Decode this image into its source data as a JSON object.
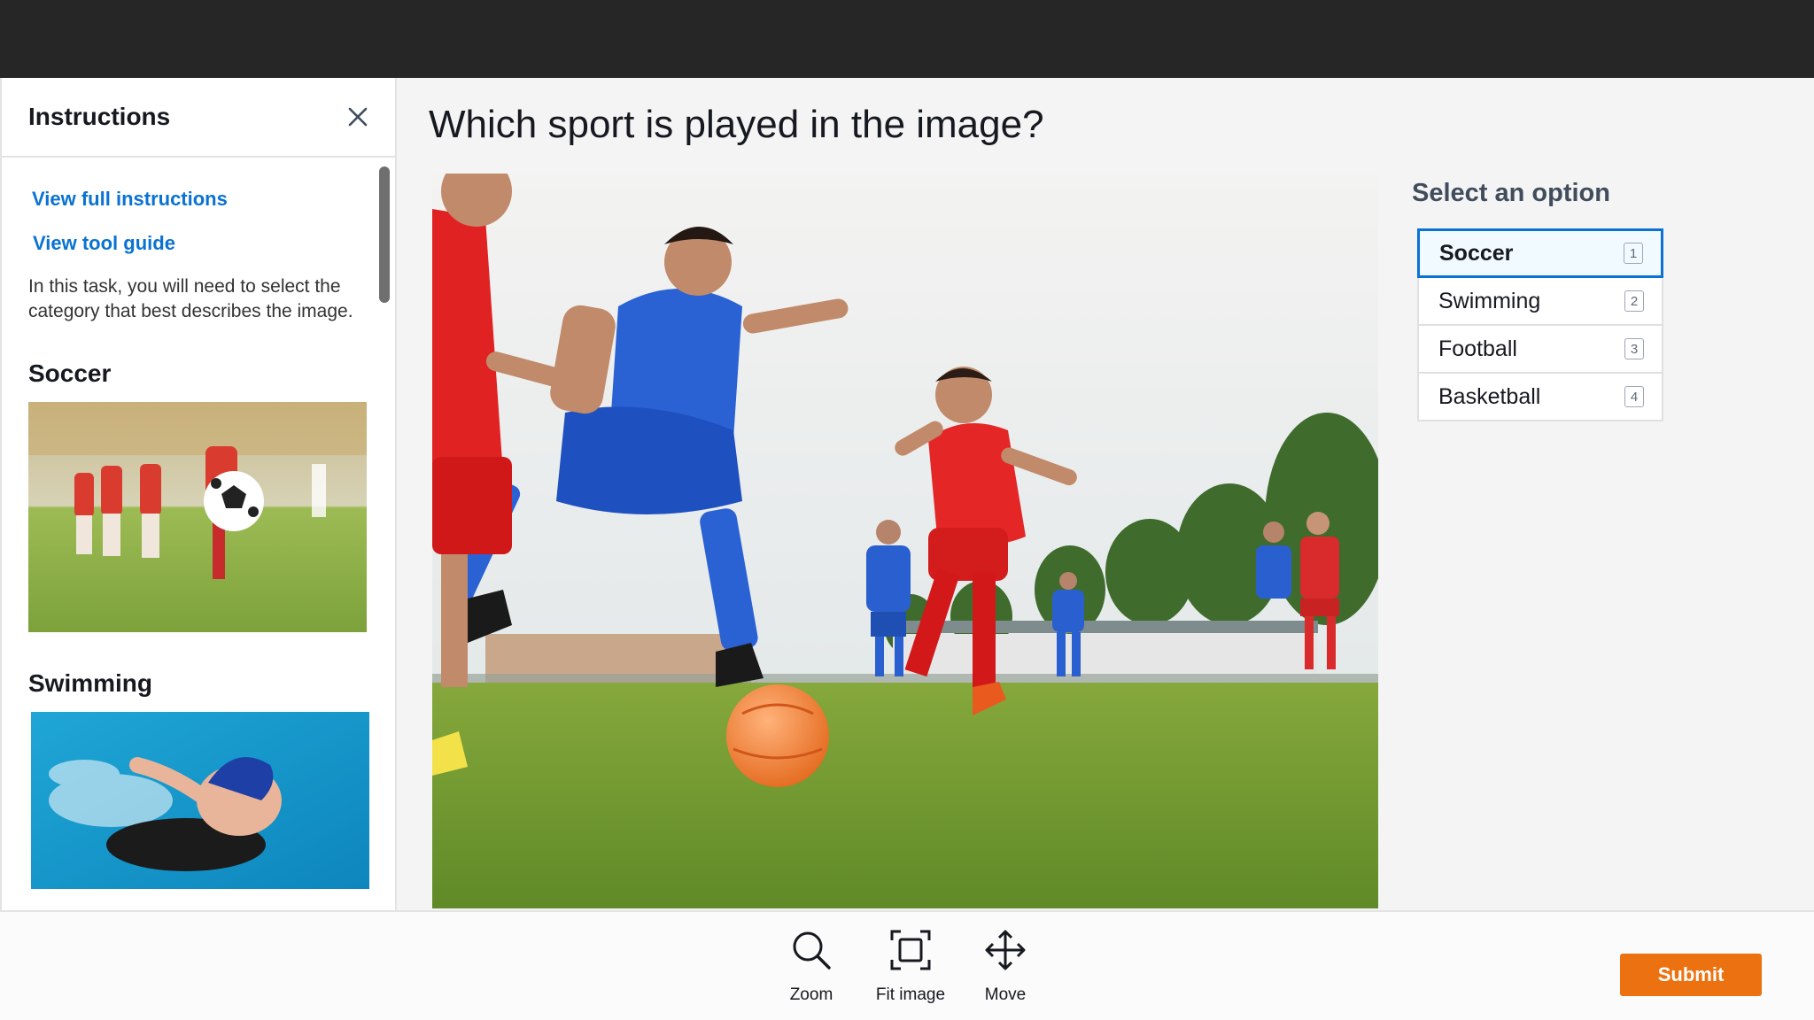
{
  "sidebar": {
    "title": "Instructions",
    "links": [
      "View full instructions",
      "View tool guide"
    ],
    "description": "In this task, you will need to select the category that best describes the image.",
    "examples": [
      {
        "label": "Soccer"
      },
      {
        "label": "Swimming"
      }
    ]
  },
  "main": {
    "question": "Which sport is played in the image?"
  },
  "options": {
    "title": "Select an option",
    "items": [
      {
        "label": "Soccer",
        "key": "1"
      },
      {
        "label": "Swimming",
        "key": "2"
      },
      {
        "label": "Football",
        "key": "3"
      },
      {
        "label": "Basketball",
        "key": "4"
      }
    ],
    "selected": "Soccer"
  },
  "toolbar": {
    "zoom_label": "Zoom",
    "fit_label": "Fit image",
    "move_label": "Move",
    "submit_label": "Submit"
  },
  "colors": {
    "accent": "#0972d3",
    "submit": "#ec7211",
    "topbar": "#262626"
  },
  "icons": [
    "close-icon",
    "zoom-icon",
    "fit-image-icon",
    "move-icon"
  ]
}
